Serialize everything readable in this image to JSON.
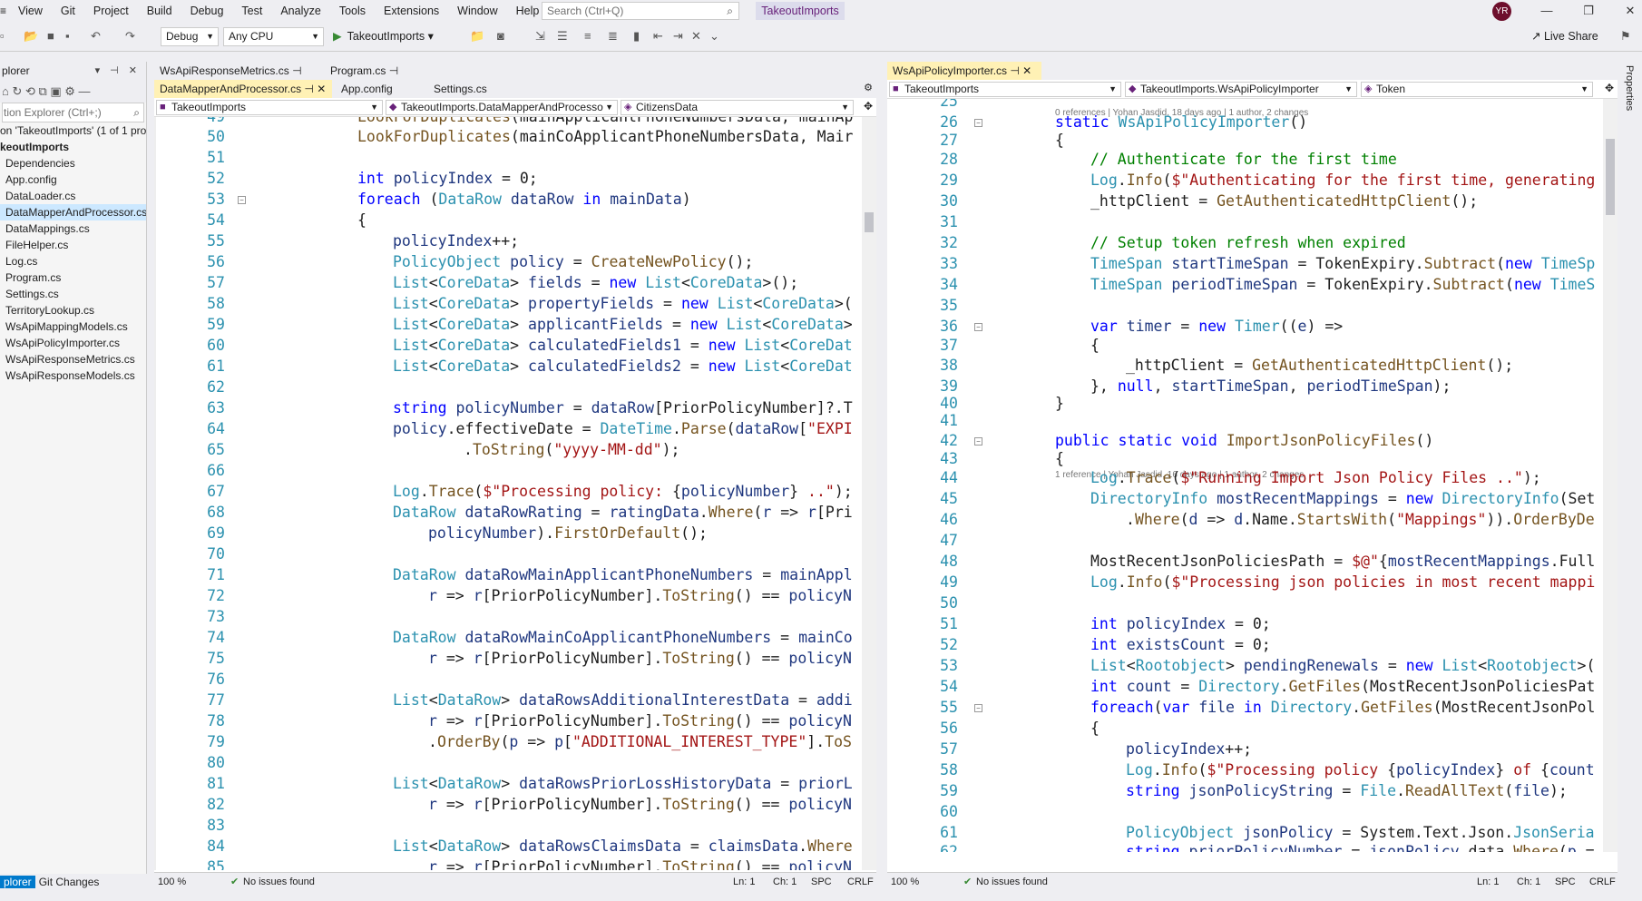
{
  "menu": [
    "View",
    "Git",
    "Project",
    "Build",
    "Debug",
    "Test",
    "Analyze",
    "Tools",
    "Extensions",
    "Window",
    "Help"
  ],
  "search": {
    "placeholder": "Search (Ctrl+Q)"
  },
  "project_name": "TakeoutImports",
  "user_initials": "YR",
  "toolbar": {
    "config": "Debug",
    "platform": "Any CPU",
    "run_target": "TakeoutImports",
    "live_share": "Live Share"
  },
  "solution_explorer": {
    "title": "plorer",
    "search_placeholder": "tion Explorer (Ctrl+;)",
    "solution_line": "on 'TakeoutImports' (1 of 1 pro",
    "project": "keoutImports",
    "items": [
      "Dependencies",
      "App.config",
      "DataLoader.cs",
      "DataMapperAndProcessor.cs",
      "DataMappings.cs",
      "FileHelper.cs",
      "Log.cs",
      "Program.cs",
      "Settings.cs",
      "TerritoryLookup.cs",
      "WsApiMappingModels.cs",
      "WsApiPolicyImporter.cs",
      "WsApiResponseMetrics.cs",
      "WsApiResponseModels.cs"
    ],
    "bottom_tabs": [
      "plorer",
      "Git Changes"
    ]
  },
  "left_editor": {
    "tabs_row1": [
      "WsApiResponseMetrics.cs",
      "Program.cs"
    ],
    "tabs_row2": [
      "DataMapperAndProcessor.cs",
      "App.config",
      "Settings.cs"
    ],
    "nav": [
      "TakeoutImports",
      "TakeoutImports.DataMapperAndProcesso",
      "CitizensData"
    ],
    "status": {
      "zoom": "100 %",
      "issues": "No issues found",
      "ln": "Ln: 1",
      "ch": "Ch: 1",
      "enc": "SPC",
      "eol": "CRLF"
    }
  },
  "right_editor": {
    "tab": "WsApiPolicyImporter.cs",
    "nav": [
      "TakeoutImports",
      "TakeoutImports.WsApiPolicyImporter",
      "Token"
    ],
    "hint1": "0 references | Yohan Jasdid, 18 days ago | 1 author, 2 changes",
    "hint2": "1 reference | Yohan Jasdid, 16 days ago | 1 author, 2 changes",
    "status": {
      "zoom": "100 %",
      "issues": "No issues found",
      "ln": "Ln: 1",
      "ch": "Ch: 1",
      "enc": "SPC",
      "eol": "CRLF"
    }
  },
  "properties_label": "Properties",
  "colors": {
    "accent": "#007acc",
    "keyword": "#0000ff",
    "type": "#2b91af",
    "string": "#a31515",
    "comment": "#008000",
    "active_tab": "#fff1b5"
  }
}
